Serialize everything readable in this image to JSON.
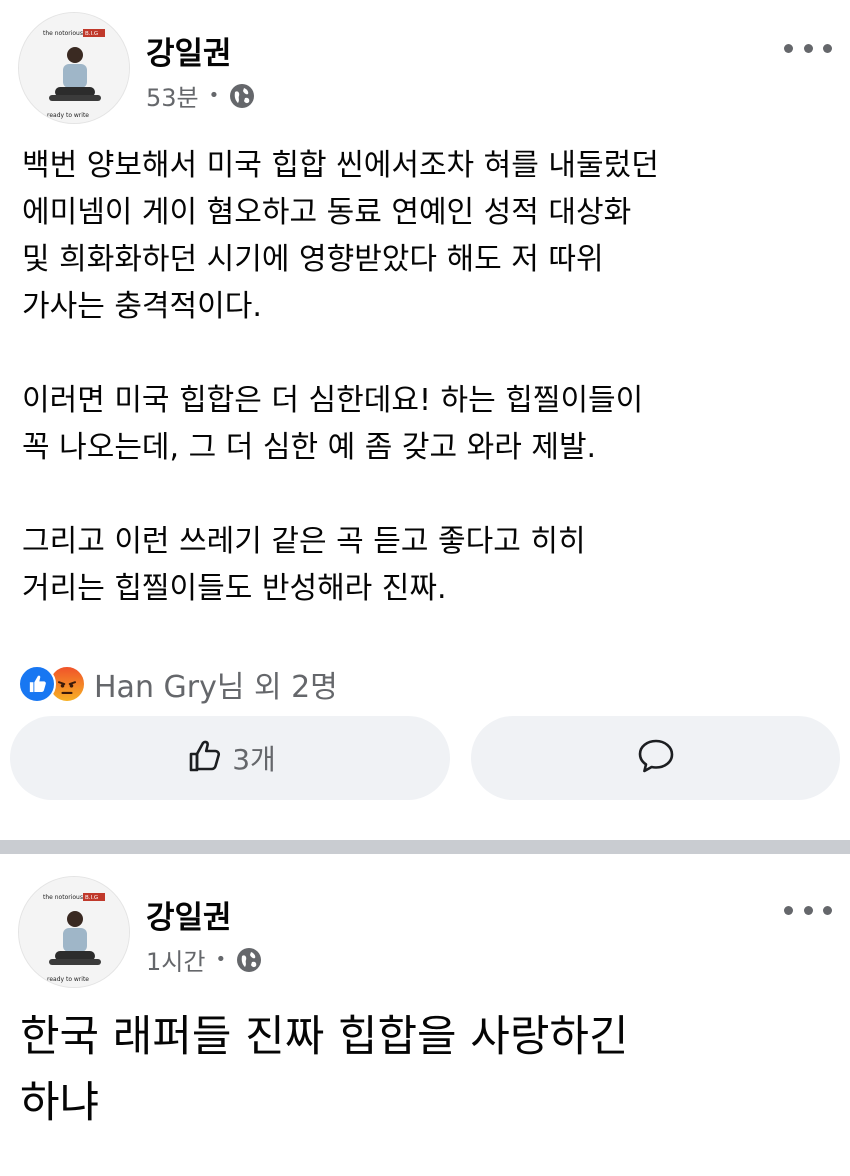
{
  "posts": [
    {
      "author": "강일권",
      "time": "53분",
      "privacy_icon": "globe-icon",
      "body": "백번 양보해서 미국 힙합 씬에서조차 혀를 내둘렀던\n에미넴이 게이 혐오하고 동료 연예인 성적 대상화\n및 희화화하던 시기에 영향받았다 해도 저 따위\n가사는 충격적이다.\n\n이러면 미국 힙합은 더 심한데요!  하는 힙찔이들이\n꼭 나오는데, 그 더 심한 예 좀 갖고 와라 제발.\n\n그리고 이런 쓰레기 같은 곡 듣고 좋다고 히히\n거리는 힙찔이들도 반성해라 진짜.",
      "reactions": {
        "icons": [
          "like-icon",
          "angry-icon"
        ],
        "summary": "Han Gry님 외 2명"
      },
      "like_count": "3개",
      "avatar_text_top": "the notorious",
      "avatar_text_badge": "B.I.G",
      "avatar_text_bottom": "ready to write"
    },
    {
      "author": "강일권",
      "time": "1시간",
      "privacy_icon": "globe-icon",
      "body": "한국 래퍼들 진짜 힙합을 사랑하긴\n하냐",
      "avatar_text_top": "the notorious",
      "avatar_text_badge": "B.I.G",
      "avatar_text_bottom": "ready to write"
    }
  ],
  "colors": {
    "like_blue": "#1877f2",
    "secondary_text": "#65676b",
    "button_bg": "#f0f2f5",
    "separator": "#c9ccd1"
  }
}
